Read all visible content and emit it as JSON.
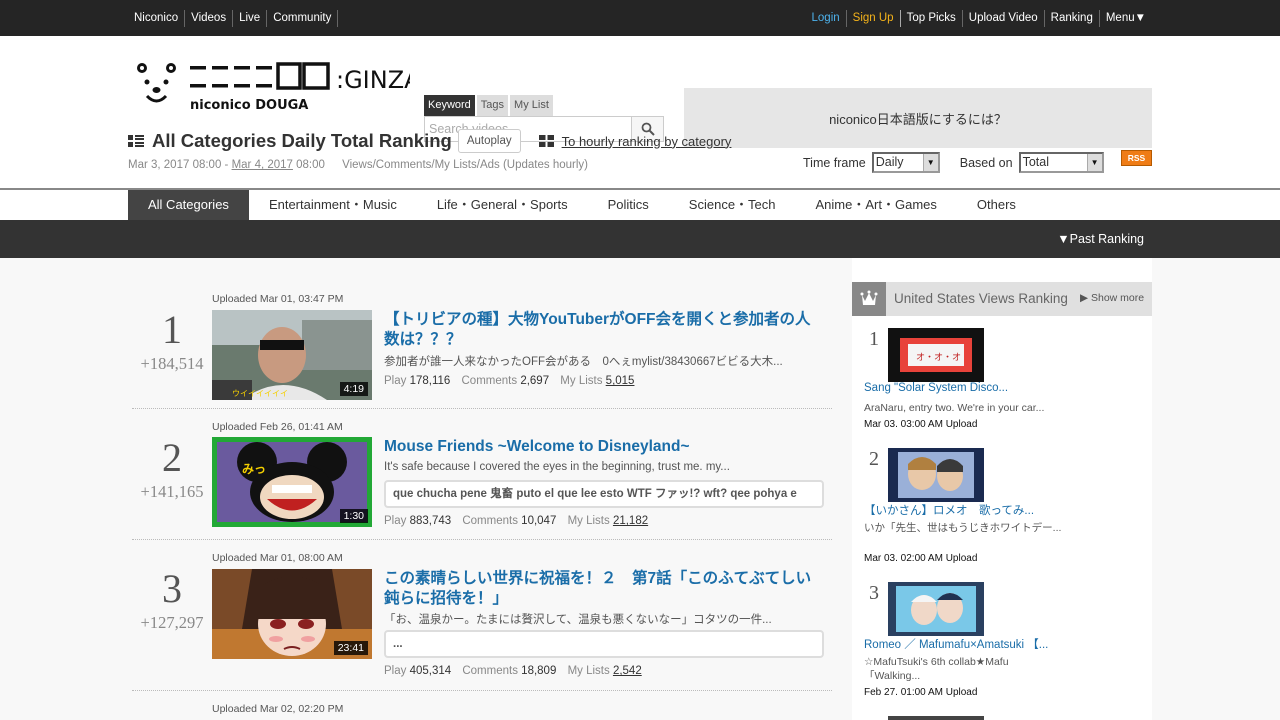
{
  "topbar": {
    "left_links": [
      "Niconico",
      "Videos",
      "Live",
      "Community"
    ],
    "login": "Login",
    "signup": "Sign Up",
    "right_links": [
      "Top Picks",
      "Upload Video",
      "Ranking",
      "Menu▼"
    ]
  },
  "header": {
    "logo_text": "niconico DOUGA GINZA",
    "search_tabs": [
      "Keyword",
      "Tags",
      "My List"
    ],
    "search_placeholder": "Search videos",
    "banner": "niconico日本語版にするには？"
  },
  "title": {
    "text": "All Categories Daily Total Ranking",
    "autoplay": "Autoplay",
    "hourly_link": "To hourly ranking by category",
    "date_start": "Mar 3, 2017 08:00 - ",
    "date_end_link": "Mar 4, 2017",
    "date_end_time": " 08:00",
    "basis_note": "Views/Comments/My Lists/Ads (Updates hourly)",
    "timeframe_label": "Time frame",
    "timeframe_value": "Daily",
    "based_on_label": "Based on",
    "based_on_value": "Total",
    "rss": "RSS"
  },
  "categories": [
    "All Categories",
    "Entertainment・Music",
    "Life・General・Sports",
    "Politics",
    "Science・Tech",
    "Anime・Art・Games",
    "Others"
  ],
  "past_ranking": "▼Past Ranking",
  "ranking": [
    {
      "uploaded": "Uploaded Mar 01, 03:47 PM",
      "rank": "1",
      "points": "+184,514",
      "duration": "4:19",
      "title": "【トリビアの種】大物YouTuberがOFF会を開くと参加者の人数は？？？",
      "desc": "参加者が誰一人来なかったOFF会がある　0へぇmylist/38430667ビビる大木...",
      "comment": "",
      "play_label": "Play",
      "play": "178,116",
      "comments_label": "Comments",
      "comments": "2,697",
      "mylists_label": "My Lists",
      "mylists": "5,015"
    },
    {
      "uploaded": "Uploaded Feb 26, 01:41 AM",
      "rank": "2",
      "points": "+141,165",
      "duration": "1:30",
      "title": "Mouse Friends ~Welcome to Disneyland~",
      "desc": "It's safe because I covered the eyes in the beginning, trust me. my...",
      "comment": "que chucha pene 鬼畜 puto el que lee esto WTF ファッ!? wft? qee pohya e",
      "play_label": "Play",
      "play": "883,743",
      "comments_label": "Comments",
      "comments": "10,047",
      "mylists_label": "My Lists",
      "mylists": "21,182"
    },
    {
      "uploaded": "Uploaded Mar 01, 08:00 AM",
      "rank": "3",
      "points": "+127,297",
      "duration": "23:41",
      "title": "この素晴らしい世界に祝福を！２　第7話「このふてぶてしい鈍らに招待を！」",
      "desc": "「お、温泉かー。たまには贅沢して、温泉も悪くないなー」コタツの一件...",
      "comment": "...",
      "play_label": "Play",
      "play": "405,314",
      "comments_label": "Comments",
      "comments": "18,809",
      "mylists_label": "My Lists",
      "mylists": "2,542"
    },
    {
      "uploaded": "Uploaded Mar 02, 02:20 PM"
    }
  ],
  "sidebar": {
    "title": "United States Views Ranking",
    "show_more": "▶ Show more",
    "items": [
      {
        "rank": "1",
        "title": "Sang \"Solar System Disco...",
        "desc": "AraNaru, entry two. We're in your car...",
        "date": "Mar 03. 03:00 AM  Upload"
      },
      {
        "rank": "2",
        "title": "【いかさん】ロメオ　歌ってみ...",
        "desc": "いか「先生、世はもうじきホワイトデー...",
        "date": "Mar 03. 02:00 AM  Upload"
      },
      {
        "rank": "3",
        "title": "Romeo ／ Mafumafu×Amatsuki 【...",
        "desc": "☆MafuTsuki's 6th collab★Mafu「Walking...",
        "date": "Feb 27. 01:00 AM  Upload"
      }
    ]
  }
}
